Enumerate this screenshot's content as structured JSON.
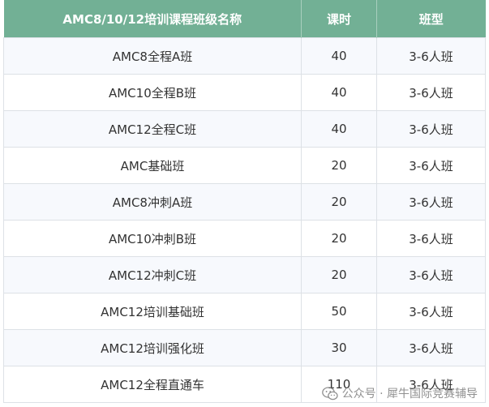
{
  "table": {
    "headers": {
      "name": "AMC8/10/12培训课程班级名称",
      "hours": "课时",
      "type": "班型"
    },
    "rows": [
      {
        "name": "AMC8全程A班",
        "hours": "40",
        "type": "3-6人班"
      },
      {
        "name": "AMC10全程B班",
        "hours": "40",
        "type": "3-6人班"
      },
      {
        "name": "AMC12全程C班",
        "hours": "40",
        "type": "3-6人班"
      },
      {
        "name": "AMC基础班",
        "hours": "20",
        "type": "3-6人班"
      },
      {
        "name": "AMC8冲刺A班",
        "hours": "20",
        "type": "3-6人班"
      },
      {
        "name": "AMC10冲刺B班",
        "hours": "20",
        "type": "3-6人班"
      },
      {
        "name": "AMC12冲刺C班",
        "hours": "20",
        "type": "3-6人班"
      },
      {
        "name": "AMC12培训基础班",
        "hours": "50",
        "type": "3-6人班"
      },
      {
        "name": "AMC12培训强化班",
        "hours": "30",
        "type": "3-6人班"
      },
      {
        "name": "AMC12全程直通车",
        "hours": "110",
        "type": "3-6人班"
      }
    ]
  },
  "watermark": {
    "icon": "wechat-icon",
    "text": "公众号 · 犀牛国际竞赛辅导"
  }
}
